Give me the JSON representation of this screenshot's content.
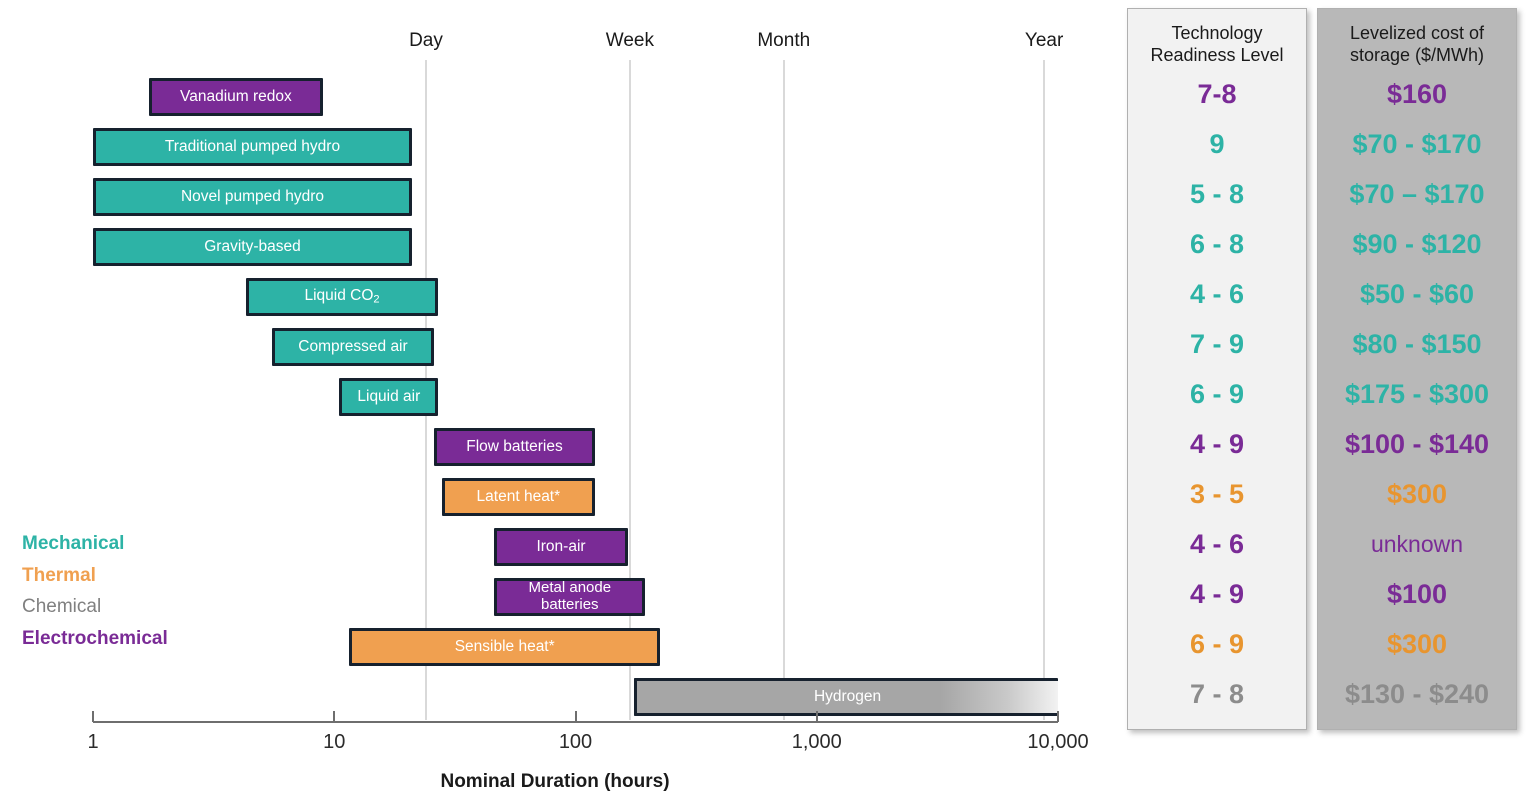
{
  "chart_data": {
    "type": "bar",
    "title": "",
    "xlabel": "Nominal Duration (hours)",
    "ylabel": "",
    "scale": "log",
    "xlim": [
      1,
      10000
    ],
    "tick_labels": [
      "1",
      "10",
      "100",
      "1,000",
      "10,000"
    ],
    "tick_values": [
      1,
      10,
      100,
      1000,
      10000
    ],
    "grid": true,
    "reference_lines": [
      {
        "label": "Day",
        "value": 24
      },
      {
        "label": "Week",
        "value": 168
      },
      {
        "label": "Month",
        "value": 730
      },
      {
        "label": "Year",
        "value": 8760
      }
    ],
    "categories": [
      "Vanadium redox",
      "Traditional pumped hydro",
      "Novel pumped hydro",
      "Gravity-based",
      "Liquid CO2",
      "Compressed air",
      "Liquid air",
      "Flow batteries",
      "Latent heat*",
      "Iron-air",
      "Metal anode batteries",
      "Sensible heat*",
      "Hydrogen"
    ],
    "bars": [
      {
        "label": "Vanadium redox",
        "label_html": "Vanadium redox",
        "category": "Electrochemical",
        "start_hours": 1.7,
        "end_hours": 9.0,
        "fade_right": false
      },
      {
        "label": "Traditional pumped hydro",
        "label_html": "Traditional pumped hydro",
        "category": "Mechanical",
        "start_hours": 1.0,
        "end_hours": 21.0,
        "fade_right": false
      },
      {
        "label": "Novel pumped hydro",
        "label_html": "Novel pumped hydro",
        "category": "Mechanical",
        "start_hours": 1.0,
        "end_hours": 21.0,
        "fade_right": false
      },
      {
        "label": "Gravity-based",
        "label_html": "Gravity-based",
        "category": "Mechanical",
        "start_hours": 1.0,
        "end_hours": 21.0,
        "fade_right": false
      },
      {
        "label": "Liquid CO2",
        "label_html": "Liquid CO<sub>2</sub>",
        "category": "Mechanical",
        "start_hours": 4.3,
        "end_hours": 27.0,
        "fade_right": false
      },
      {
        "label": "Compressed air",
        "label_html": "Compressed air",
        "category": "Mechanical",
        "start_hours": 5.5,
        "end_hours": 26.0,
        "fade_right": false
      },
      {
        "label": "Liquid air",
        "label_html": "Liquid air",
        "category": "Mechanical",
        "start_hours": 10.5,
        "end_hours": 27.0,
        "fade_right": false
      },
      {
        "label": "Flow batteries",
        "label_html": "Flow batteries",
        "category": "Electrochemical",
        "start_hours": 26.0,
        "end_hours": 120.0,
        "fade_right": false
      },
      {
        "label": "Latent heat*",
        "label_html": "Latent heat*",
        "category": "Thermal",
        "start_hours": 28.0,
        "end_hours": 120.0,
        "fade_right": false
      },
      {
        "label": "Iron-air",
        "label_html": "Iron-air",
        "category": "Electrochemical",
        "start_hours": 46.0,
        "end_hours": 165.0,
        "fade_right": false
      },
      {
        "label": "Metal anode batteries",
        "label_html": "Metal anode<br>batteries",
        "category": "Electrochemical",
        "start_hours": 46.0,
        "end_hours": 195.0,
        "fade_right": false
      },
      {
        "label": "Sensible heat*",
        "label_html": "Sensible heat*",
        "category": "Thermal",
        "start_hours": 11.5,
        "end_hours": 225.0,
        "fade_right": false
      },
      {
        "label": "Hydrogen",
        "label_html": "Hydrogen",
        "category": "Chemical",
        "start_hours": 175.0,
        "end_hours": 10000.0,
        "fade_right": true
      }
    ]
  },
  "legend": {
    "items": [
      {
        "label": "Mechanical",
        "color": "#2db3a6"
      },
      {
        "label": "Thermal",
        "color": "#f0a050"
      },
      {
        "label": "Chemical",
        "color": "#808080"
      },
      {
        "label": "Electrochemical",
        "color": "#7a2b96"
      }
    ]
  },
  "axis": {
    "title": "Nominal Duration (hours)",
    "ticks": [
      "1",
      "10",
      "100",
      "1,000",
      "10,000"
    ]
  },
  "top_labels": [
    "Day",
    "Week",
    "Month",
    "Year"
  ],
  "table": {
    "columns": [
      {
        "header": "Technology\nReadiness Level",
        "header_line1": "Technology",
        "header_line2": "Readiness Level"
      },
      {
        "header": "Levelized cost of storage ($/MWh)",
        "header_line1": "Levelized cost of",
        "header_line2": "storage ($/MWh)"
      }
    ],
    "rows": [
      {
        "technology": "Vanadium redox",
        "trl": "7-8",
        "lcos": "$160",
        "category": "Electrochemical"
      },
      {
        "technology": "Traditional pumped hydro",
        "trl": "9",
        "lcos": "$70 - $170",
        "category": "Mechanical"
      },
      {
        "technology": "Novel pumped hydro",
        "trl": "5 - 8",
        "lcos": "$70 – $170",
        "category": "Mechanical"
      },
      {
        "technology": "Gravity-based",
        "trl": "6 - 8",
        "lcos": "$90 - $120",
        "category": "Mechanical"
      },
      {
        "technology": "Liquid CO2",
        "trl": "4 - 6",
        "lcos": "$50 - $60",
        "category": "Mechanical"
      },
      {
        "technology": "Compressed air",
        "trl": "7 - 9",
        "lcos": "$80 - $150",
        "category": "Mechanical"
      },
      {
        "technology": "Liquid air",
        "trl": "6 - 9",
        "lcos": "$175 - $300",
        "category": "Mechanical"
      },
      {
        "technology": "Flow batteries",
        "trl": "4 - 9",
        "lcos": "$100 - $140",
        "category": "Electrochemical"
      },
      {
        "technology": "Latent heat*",
        "trl": "3 - 5",
        "lcos": "$300",
        "category": "Thermal"
      },
      {
        "technology": "Iron-air",
        "trl": "4 - 6",
        "lcos": "unknown",
        "category": "Electrochemical"
      },
      {
        "technology": "Metal anode batteries",
        "trl": "4 - 9",
        "lcos": "$100",
        "category": "Electrochemical"
      },
      {
        "technology": "Sensible heat*",
        "trl": "6 - 9",
        "lcos": "$300",
        "category": "Thermal"
      },
      {
        "technology": "Hydrogen",
        "trl": "7 - 8",
        "lcos": "$130 - $240",
        "category": "Chemical"
      }
    ]
  },
  "colors": {
    "mechanical": "#2db3a6",
    "thermal": "#f0a050",
    "chemical": "#a6a6a6",
    "electrochemical": "#7a2b96",
    "bar_border": "#16212e",
    "gridline": "#d9d9d9",
    "panel_trl_bg": "#f2f2f2",
    "panel_lcos_bg": "#b8b8b8"
  }
}
